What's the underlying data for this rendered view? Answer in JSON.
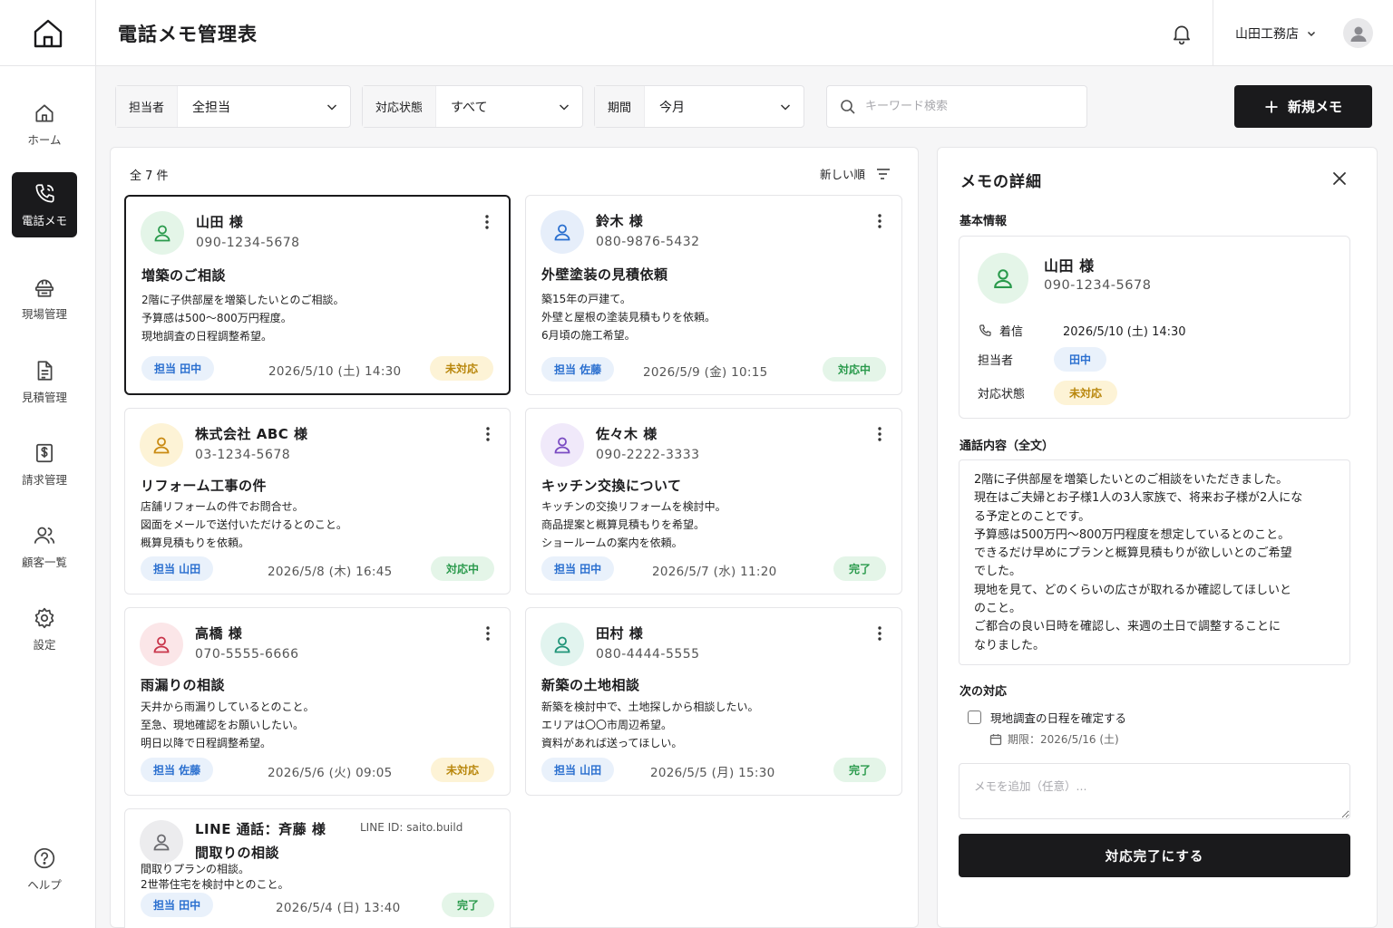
{
  "header": {
    "title": "電話メモ管理表",
    "company": "山田工務店"
  },
  "sidebar": {
    "items": [
      {
        "label": "ホーム",
        "icon": "home-icon"
      },
      {
        "label": "電話メモ",
        "icon": "phone-icon",
        "active": true
      },
      {
        "label": "現場管理",
        "icon": "site-icon"
      },
      {
        "label": "見積管理",
        "icon": "document-icon"
      },
      {
        "label": "請求管理",
        "icon": "invoice-icon"
      },
      {
        "label": "顧客一覧",
        "icon": "users-icon"
      },
      {
        "label": "設定",
        "icon": "gear-icon"
      },
      {
        "label": "ヘルプ",
        "icon": "help-icon"
      }
    ]
  },
  "filters": {
    "assignee": {
      "label": "担当者",
      "value": "全担当"
    },
    "status": {
      "label": "対応状態",
      "value": "すべて"
    },
    "period": {
      "label": "期間",
      "value": "今月"
    },
    "search_placeholder": "キーワード検索",
    "new_button": "新規メモ"
  },
  "list": {
    "count": "全 7 件",
    "sort": "新しい順",
    "cards": [
      {
        "name": "山田 様",
        "phone": "090-1234-5678",
        "subject": "増築のご相談",
        "body": [
          "2階に子供部屋を増築したいとのご相談。",
          "予算感は500〜800万円程度。",
          "現地調査の日程調整希望。"
        ],
        "assignee": "担当 田中",
        "date": "2026/5/10 (土) 14:30",
        "status": "未対応"
      },
      {
        "name": "鈴木 様",
        "phone": "080-9876-5432",
        "subject": "外壁塗装の見積依頼",
        "body": [
          "築15年の戸建て。",
          "外壁と屋根の塗装見積もりを依頼。",
          "6月頃の施工希望。"
        ],
        "assignee": "担当 佐藤",
        "date": "2026/5/9 (金) 10:15",
        "status": "対応中"
      },
      {
        "name": "株式会社 ABC 様",
        "phone": "03-1234-5678",
        "subject": "リフォーム工事の件",
        "body": [
          "店舗リフォームの件でお問合せ。",
          "図面をメールで送付いただけるとのこと。",
          "概算見積もりを依頼。"
        ],
        "assignee": "担当 山田",
        "date": "2026/5/8 (木) 16:45",
        "status": "対応中"
      },
      {
        "name": "佐々木 様",
        "phone": "090-2222-3333",
        "subject": "キッチン交換について",
        "body": [
          "キッチンの交換リフォームを検討中。",
          "商品提案と概算見積もりを希望。",
          "ショールームの案内を依頼。"
        ],
        "assignee": "担当 田中",
        "date": "2026/5/7 (水) 11:20",
        "status": "完了"
      },
      {
        "name": "高橋 様",
        "phone": "070-5555-6666",
        "subject": "雨漏りの相談",
        "body": [
          "天井から雨漏りしているとのこと。",
          "至急、現地確認をお願いしたい。",
          "明日以降で日程調整希望。"
        ],
        "assignee": "担当 佐藤",
        "date": "2026/5/6 (火) 09:05",
        "status": "未対応"
      },
      {
        "name": "田村 様",
        "phone": "080-4444-5555",
        "subject": "新築の土地相談",
        "body": [
          "新築を検討中で、土地探しから相談したい。",
          "エリアは〇〇市周辺希望。",
          "資料があれば送ってほしい。"
        ],
        "assignee": "担当 山田",
        "date": "2026/5/5 (月) 15:30",
        "status": "完了"
      },
      {
        "name": "LINE 通話：斉藤 様",
        "line_id": "LINE ID: saito.build",
        "subject": "間取りの相談",
        "body": [
          "間取りプランの相談。",
          "2世帯住宅を検討中とのこと。"
        ],
        "assignee": "担当 田中",
        "date": "2026/5/4 (日) 13:40",
        "status": "完了"
      }
    ]
  },
  "detail": {
    "title": "メモの詳細",
    "basic_info": "基本情報",
    "name": "山田 様",
    "phone": "090-1234-5678",
    "call_type_label": "着信",
    "call_datetime": "2026/5/10 (土) 14:30",
    "assignee_label": "担当者",
    "assignee": "田中",
    "status_label": "対応状態",
    "status": "未対応",
    "fulltext_title": "通話内容（全文）",
    "fulltext": [
      "2階に子供部屋を増築したいとのご相談をいただきました。",
      "現在はご夫婦とお子様1人の3人家族で、将来お子様が2人にな",
      "る予定とのことです。",
      "予算感は500万円〜800万円程度を想定しているとのこと。",
      "できるだけ早めにプランと概算見積もりが欲しいとのご希望",
      "でした。",
      "現地を見て、どのくらいの広さが取れるか確認してほしいと",
      "のこと。",
      "ご都合の良い日時を確認し、来週の土日で調整することに",
      "なりました。"
    ],
    "next_action_title": "次の対応",
    "todo": "現地調査の日程を確定する",
    "due": "期限：2026/5/16 (土)",
    "memo_placeholder": "メモを追加（任意）...",
    "complete_button": "対応完了にする"
  },
  "colors": {
    "accent_dark": "#1a1a1c",
    "tag_blue": "#2a6fcf",
    "status_pending": "#b8860b",
    "status_progress": "#2a9a4c"
  }
}
